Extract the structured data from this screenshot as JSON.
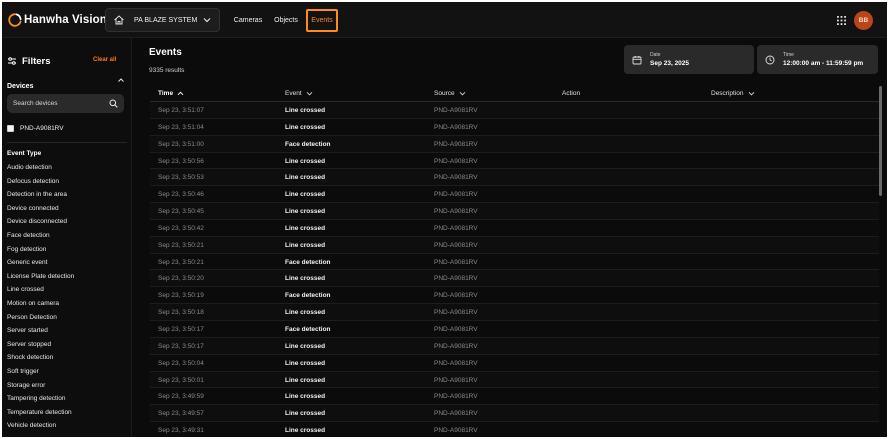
{
  "app": {
    "brand_name": "Hanwha Vision",
    "accent_color": "#ff8c1a"
  },
  "header": {
    "site_selector": {
      "value": "PA BLAZE SYSTEM",
      "icon": "home-icon"
    },
    "nav": [
      {
        "label": "Cameras",
        "active": false
      },
      {
        "label": "Objects",
        "active": false
      },
      {
        "label": "Events",
        "active": true
      }
    ],
    "apps_icon": "apps-grid-icon",
    "avatar_initials": "BB"
  },
  "sidebar": {
    "title": "Filters",
    "clear_all": "Clear all",
    "devices": {
      "title": "Devices",
      "search_placeholder": "Search devices",
      "items": [
        {
          "label": "PND-A9081RV",
          "checked": false
        }
      ]
    },
    "event_type": {
      "title": "Event Type",
      "items": [
        "Audio detection",
        "Defocus detection",
        "Detection in the area",
        "Device connected",
        "Device disconnected",
        "Face detection",
        "Fog detection",
        "Generic event",
        "License Plate detection",
        "Line crossed",
        "Motion on camera",
        "Person Detection",
        "Server started",
        "Server stopped",
        "Shock detection",
        "Soft trigger",
        "Storage error",
        "Tampering detection",
        "Temperature detection",
        "Vehicle detection"
      ]
    }
  },
  "main": {
    "title": "Events",
    "results": "9335 results",
    "date_filter": {
      "label": "Date",
      "value": "Sep 23, 2025"
    },
    "time_filter": {
      "label": "Time",
      "value": "12:00:00 am - 11:59:59 pm"
    },
    "table": {
      "columns": [
        "Time",
        "Event",
        "Source",
        "Action",
        "Description"
      ],
      "rows": [
        {
          "time": "Sep 23, 3:51:07",
          "event": "Line crossed",
          "source": "PND-A9081RV"
        },
        {
          "time": "Sep 23, 3:51:04",
          "event": "Line crossed",
          "source": "PND-A9081RV"
        },
        {
          "time": "Sep 23, 3:51:00",
          "event": "Face detection",
          "source": "PND-A9081RV"
        },
        {
          "time": "Sep 23, 3:50:56",
          "event": "Line crossed",
          "source": "PND-A9081RV"
        },
        {
          "time": "Sep 23, 3:50:53",
          "event": "Line crossed",
          "source": "PND-A9081RV"
        },
        {
          "time": "Sep 23, 3:50:46",
          "event": "Line crossed",
          "source": "PND-A9081RV"
        },
        {
          "time": "Sep 23, 3:50:45",
          "event": "Line crossed",
          "source": "PND-A9081RV"
        },
        {
          "time": "Sep 23, 3:50:42",
          "event": "Line crossed",
          "source": "PND-A9081RV"
        },
        {
          "time": "Sep 23, 3:50:21",
          "event": "Line crossed",
          "source": "PND-A9081RV"
        },
        {
          "time": "Sep 23, 3:50:21",
          "event": "Face detection",
          "source": "PND-A9081RV"
        },
        {
          "time": "Sep 23, 3:50:20",
          "event": "Line crossed",
          "source": "PND-A9081RV"
        },
        {
          "time": "Sep 23, 3:50:19",
          "event": "Face detection",
          "source": "PND-A9081RV"
        },
        {
          "time": "Sep 23, 3:50:18",
          "event": "Line crossed",
          "source": "PND-A9081RV"
        },
        {
          "time": "Sep 23, 3:50:17",
          "event": "Face detection",
          "source": "PND-A9081RV"
        },
        {
          "time": "Sep 23, 3:50:17",
          "event": "Line crossed",
          "source": "PND-A9081RV"
        },
        {
          "time": "Sep 23, 3:50:04",
          "event": "Line crossed",
          "source": "PND-A9081RV"
        },
        {
          "time": "Sep 23, 3:50:01",
          "event": "Line crossed",
          "source": "PND-A9081RV"
        },
        {
          "time": "Sep 23, 3:49:59",
          "event": "Line crossed",
          "source": "PND-A9081RV"
        },
        {
          "time": "Sep 23, 3:49:57",
          "event": "Line crossed",
          "source": "PND-A9081RV"
        },
        {
          "time": "Sep 23, 3:49:31",
          "event": "Line crossed",
          "source": "PND-A9081RV"
        }
      ]
    }
  }
}
